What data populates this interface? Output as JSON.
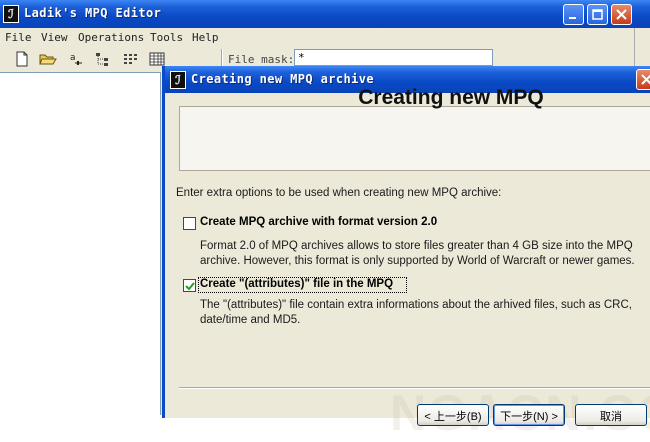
{
  "main_window": {
    "title": "Ladik's MPQ Editor",
    "icon_glyph": "ℐ",
    "menu": [
      "File",
      "View",
      "Operations",
      "Tools",
      "Help"
    ],
    "toolbar_icons": [
      "new-icon",
      "open-icon",
      "rename-icon",
      "tree-view-icon",
      "list-view-icon",
      "grid-view-icon"
    ],
    "file_mask_label": "File mask:",
    "file_mask_value": "*"
  },
  "dialog": {
    "title": "Creating new MPQ archive",
    "icon_glyph": "ℐ",
    "header": "Creating new MPQ",
    "intro": "Enter extra options to be used when creating new MPQ archive:",
    "options": [
      {
        "label": "Create MPQ archive with format version 2.0",
        "checked": false,
        "description_lines": [
          "Format 2.0 of MPQ archives allows to store files greater than 4 GB size into the MPQ",
          "archive. However, this format is only supported by World of Warcraft or newer games."
        ]
      },
      {
        "label": "Create \"(attributes)\" file in the MPQ",
        "checked": true,
        "description_lines": [
          "The \"(attributes)\" file contain extra informations about the arhived files, such as CRC,",
          "date/time and MD5."
        ]
      }
    ],
    "watermark": "NGACN.CC",
    "buttons": {
      "back": "< 上一步(B)",
      "next": "下一步(N) >",
      "cancel": "取消"
    }
  },
  "colors": {
    "titlebar_blue": "#0a49c6",
    "window_face": "#ece9d8",
    "close_red": "#c73b17"
  }
}
